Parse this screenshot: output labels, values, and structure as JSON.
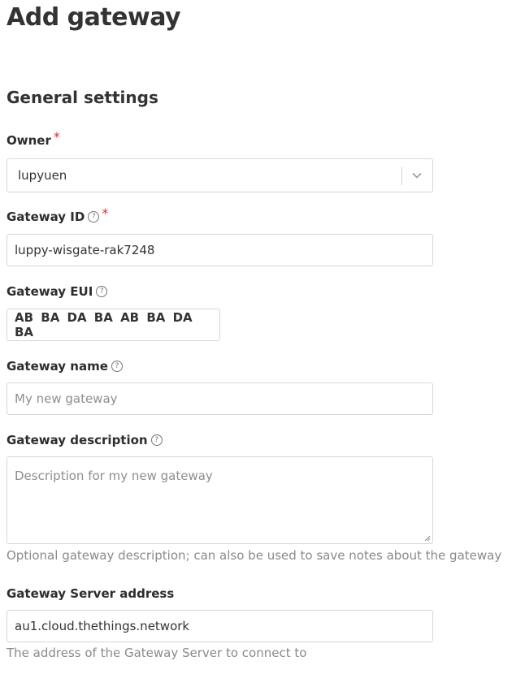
{
  "page": {
    "title": "Add gateway",
    "section_title": "General settings"
  },
  "form": {
    "owner": {
      "label": "Owner",
      "required_mark": "*",
      "value": "lupyuen"
    },
    "gateway_id": {
      "label": "Gateway ID",
      "help": "?",
      "required_mark": "*",
      "value": "luppy-wisgate-rak7248"
    },
    "gateway_eui": {
      "label": "Gateway EUI",
      "help": "?",
      "value": "AB BA DA BA AB BA DA BA"
    },
    "gateway_name": {
      "label": "Gateway name",
      "help": "?",
      "placeholder": "My new gateway"
    },
    "gateway_description": {
      "label": "Gateway description",
      "help": "?",
      "placeholder": "Description for my new gateway",
      "hint": "Optional gateway description; can also be used to save notes about the gateway"
    },
    "gateway_server_address": {
      "label": "Gateway Server address",
      "value": "au1.cloud.thethings.network",
      "hint": "The address of the Gateway Server to connect to"
    }
  },
  "colors": {
    "required": "#e02b2b",
    "border": "#d7d7d7",
    "hint_text": "#8a8a8a"
  }
}
